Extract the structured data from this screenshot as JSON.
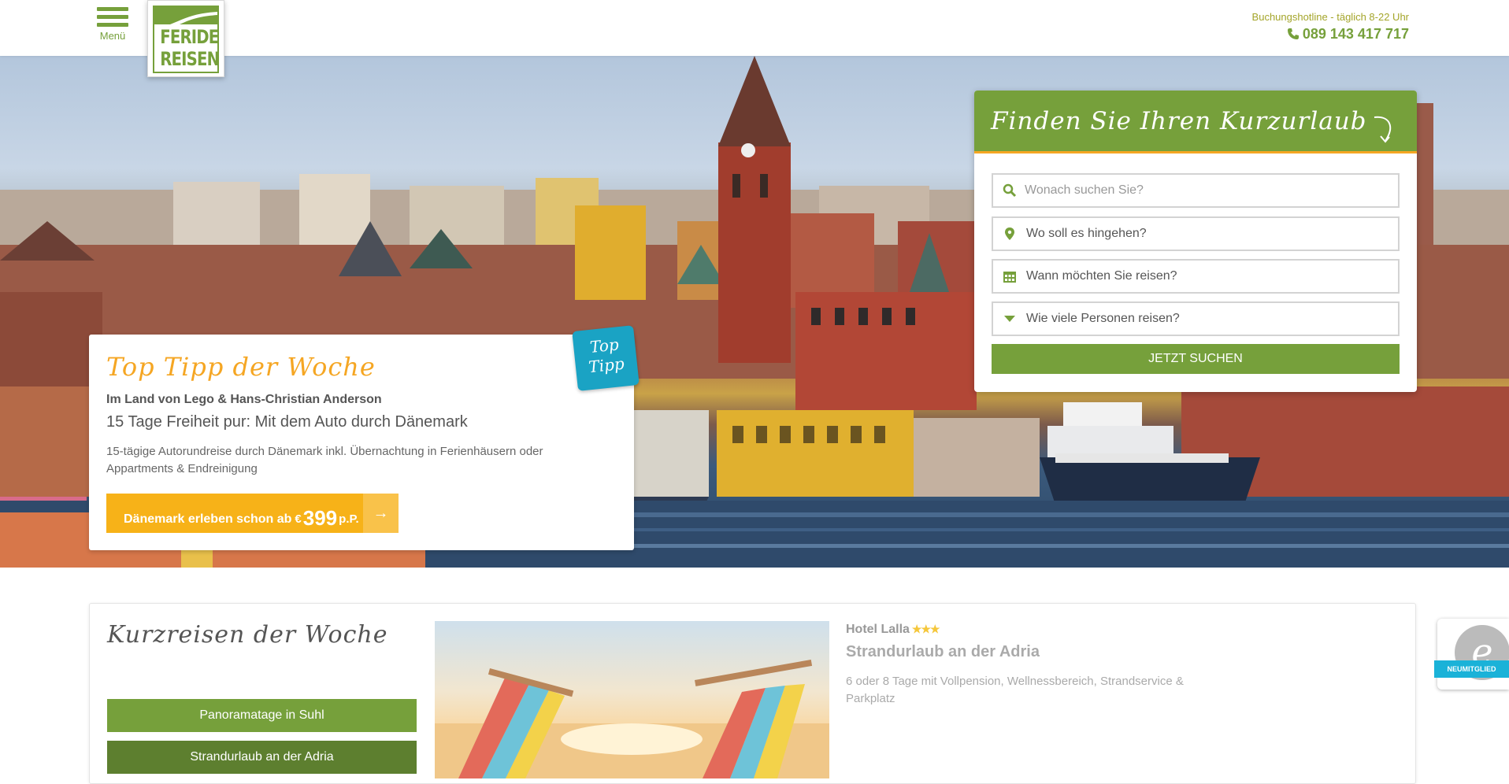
{
  "header": {
    "menu_label": "Menü",
    "logo_line1": "FERIDE",
    "logo_line2": "REISEN",
    "hotline_label": "Buchungshotline - täglich 8-22 Uhr",
    "hotline_phone": "089 143 417 717"
  },
  "top_tip": {
    "title": "Top Tipp der Woche",
    "badge_line1": "Top",
    "badge_line2": "Tipp",
    "subtitle": "Im Land von Lego & Hans-Christian Anderson",
    "headline": "15 Tage Freiheit pur: Mit dem Auto durch Dänemark",
    "description": "15-tägige Autorundreise durch Dänemark inkl. Übernachtung in Ferienhäusern oder Appartments & Endreinigung",
    "cta_text": "Dänemark erleben schon ab",
    "cta_currency": "€",
    "cta_price": "399",
    "cta_per": "p.P.",
    "cta_arrow": "→"
  },
  "search": {
    "title": "Finden Sie Ihren Kurzurlaub",
    "query_placeholder": "Wonach suchen Sie?",
    "destination_label": "Wo soll es hingehen?",
    "date_label": "Wann möchten Sie reisen?",
    "persons_label": "Wie viele Personen reisen?",
    "submit_label": "JETZT SUCHEN"
  },
  "kurzreisen": {
    "title": "Kurzreisen der Woche",
    "items": [
      {
        "label": "Panoramatage in Suhl"
      },
      {
        "label": "Strandurlaub an der Adria"
      }
    ],
    "hotel_name": "Hotel Lalla",
    "hotel_stars": "★★★",
    "headline": "Strandurlaub an der Adria",
    "description": "6 oder 8 Tage mit Vollpension, Wellnessbereich, Strandservice & Parkplatz"
  },
  "seal": {
    "letter": "e",
    "label": "NEUMITGLIED"
  },
  "colors": {
    "brand_green": "#76a03b",
    "accent_orange": "#f5a623",
    "cta_yellow": "#f7b218",
    "badge_blue": "#1aa3c4"
  }
}
